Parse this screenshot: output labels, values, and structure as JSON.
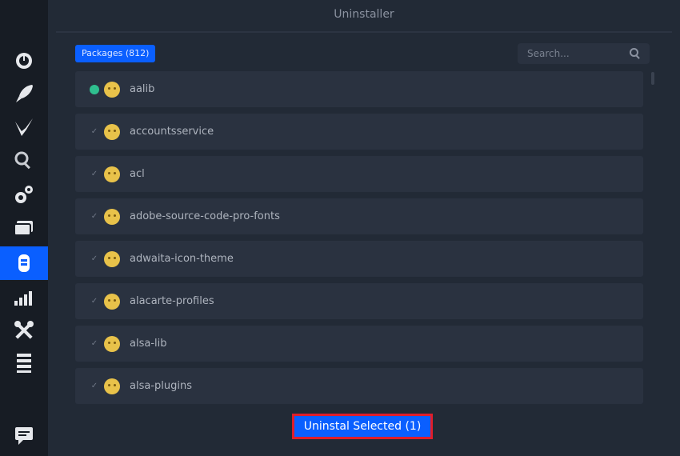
{
  "window": {
    "title": "Uninstaller"
  },
  "toolbar": {
    "packages_badge": "Packages (812)"
  },
  "search": {
    "placeholder": "Search..."
  },
  "packages": [
    {
      "name": "aalib",
      "checked": true
    },
    {
      "name": "accountsservice",
      "checked": false
    },
    {
      "name": "acl",
      "checked": false
    },
    {
      "name": "adobe-source-code-pro-fonts",
      "checked": false
    },
    {
      "name": "adwaita-icon-theme",
      "checked": false
    },
    {
      "name": "alacarte-profiles",
      "checked": false
    },
    {
      "name": "alsa-lib",
      "checked": false
    },
    {
      "name": "alsa-plugins",
      "checked": false
    }
  ],
  "actions": {
    "uninstall_label": "Uninstal Selected (1)"
  },
  "sidebar": {
    "items": [
      {
        "icon": "dashboard-icon"
      },
      {
        "icon": "rocket-icon"
      },
      {
        "icon": "broom-icon"
      },
      {
        "icon": "search-icon"
      },
      {
        "icon": "gears-icon"
      },
      {
        "icon": "layers-icon"
      },
      {
        "icon": "uninstaller-icon",
        "active": true
      },
      {
        "icon": "resources-icon"
      },
      {
        "icon": "tools-icon"
      },
      {
        "icon": "settings-list-icon"
      },
      {
        "icon": "chat-icon"
      }
    ]
  },
  "colors": {
    "accent": "#0a5fff",
    "highlight_border": "#e01e2a",
    "checked": "#2fbf8f"
  }
}
